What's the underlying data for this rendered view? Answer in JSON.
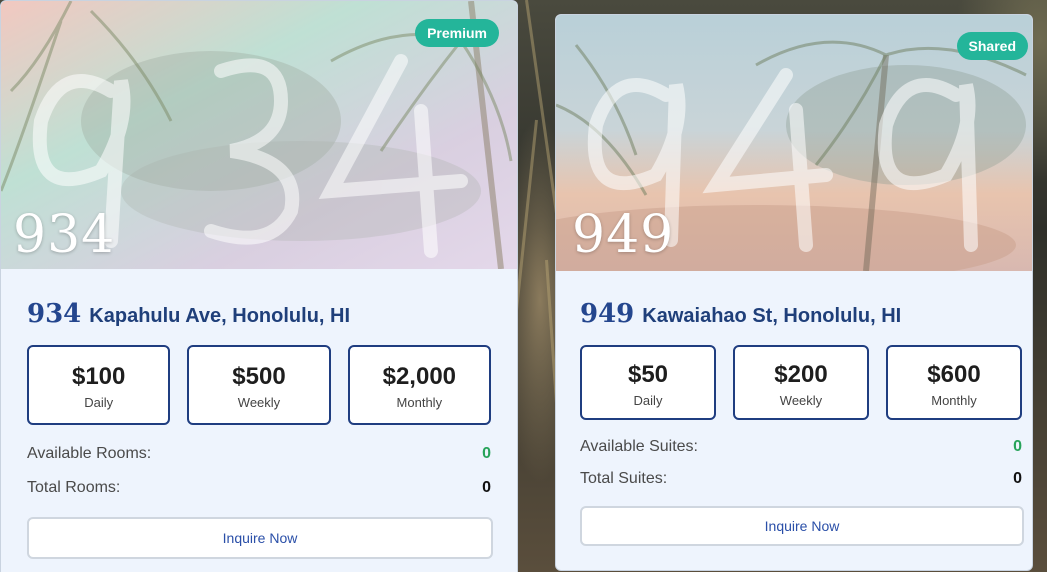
{
  "listings": [
    {
      "badge": "Premium",
      "hero_number": "934",
      "address_number": "934",
      "address_street": "Kapahulu Ave, Honolulu, HI",
      "prices": [
        {
          "amount": "$100",
          "period": "Daily"
        },
        {
          "amount": "$500",
          "period": "Weekly"
        },
        {
          "amount": "$2,000",
          "period": "Monthly"
        }
      ],
      "available_label": "Available Rooms:",
      "available_value": "0",
      "total_label": "Total Rooms:",
      "total_value": "0",
      "button_label": "Inquire Now"
    },
    {
      "badge": "Shared",
      "hero_number": "949",
      "address_number": "949",
      "address_street": "Kawaiahao St, Honolulu, HI",
      "prices": [
        {
          "amount": "$50",
          "period": "Daily"
        },
        {
          "amount": "$200",
          "period": "Weekly"
        },
        {
          "amount": "$600",
          "period": "Monthly"
        }
      ],
      "available_label": "Available Suites:",
      "available_value": "0",
      "total_label": "Total Suites:",
      "total_value": "0",
      "button_label": "Inquire Now"
    }
  ],
  "colors": {
    "badge": "#24b59a",
    "accent_navy": "#1f3d80",
    "available_green": "#27a35a",
    "card_background": "#eef4fd"
  },
  "icons": [
    "palm-tree-image"
  ]
}
